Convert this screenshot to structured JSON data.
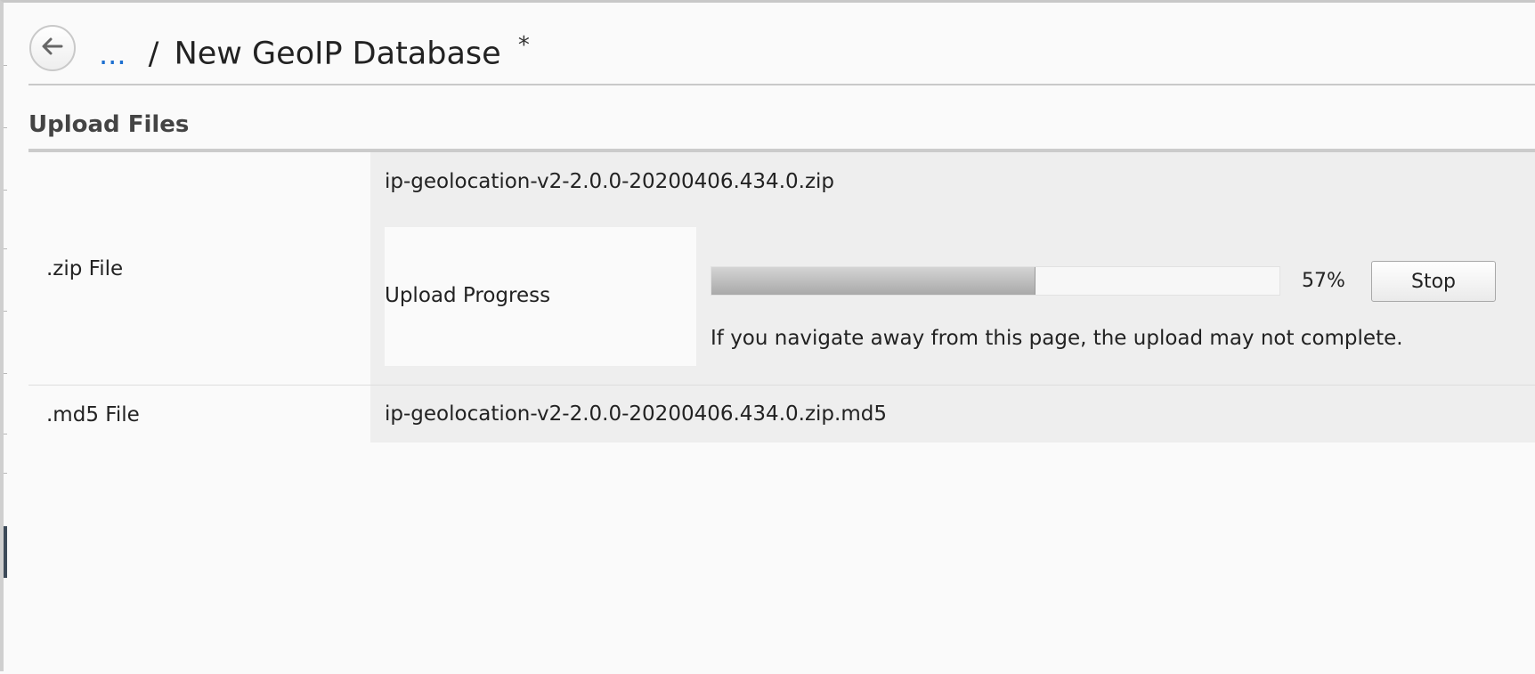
{
  "header": {
    "back_icon": "arrow-left-icon",
    "breadcrumb_link": "...",
    "separator": "/",
    "title": "New GeoIP Database",
    "unsaved_marker": "*"
  },
  "section": {
    "title": "Upload Files"
  },
  "rows": {
    "zip": {
      "label": ".zip File",
      "filename": "ip-geolocation-v2-2.0.0-20200406.434.0.zip",
      "progress_label": "Upload Progress",
      "progress_fraction": 0.57,
      "percent_text": "57%",
      "stop_label": "Stop",
      "warning": "If you navigate away from this page, the upload may not complete."
    },
    "md5": {
      "label": ".md5 File",
      "filename": "ip-geolocation-v2-2.0.0-20200406.434.0.zip.md5"
    }
  },
  "colors": {
    "link": "#1c6fd0",
    "cell_background": "#eeeeee",
    "page_background": "#fafafa"
  }
}
